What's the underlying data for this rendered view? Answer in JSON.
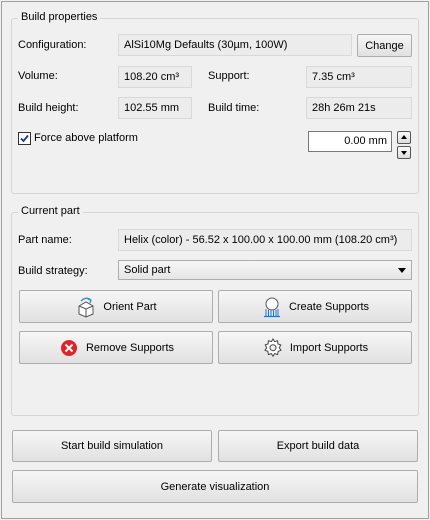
{
  "build_properties": {
    "title": "Build properties",
    "configuration_label": "Configuration:",
    "configuration_value": "AlSi10Mg Defaults (30µm, 100W)",
    "change_label": "Change",
    "volume_label": "Volume:",
    "volume_value": "108.20 cm³",
    "support_label": "Support:",
    "support_value": "7.35 cm³",
    "build_height_label": "Build height:",
    "build_height_value": "102.55 mm",
    "build_time_label": "Build time:",
    "build_time_value": "28h 26m 21s",
    "force_above_label": "Force above platform",
    "force_above_checked": true,
    "offset_value": "0.00 mm"
  },
  "current_part": {
    "title": "Current part",
    "part_name_label": "Part name:",
    "part_name_value": "Helix (color) - 56.52 x 100.00 x 100.00 mm (108.20 cm³)",
    "build_strategy_label": "Build strategy:",
    "build_strategy_value": "Solid part",
    "orient_part_label": "Orient Part",
    "create_supports_label": "Create Supports",
    "remove_supports_label": "Remove Supports",
    "import_supports_label": "Import Supports"
  },
  "actions": {
    "start_simulation_label": "Start build simulation",
    "export_data_label": "Export build data",
    "generate_visualization_label": "Generate visualization"
  },
  "icons": {
    "orient": "orient-part-icon",
    "create_supports": "create-supports-icon",
    "remove_supports": "remove-icon",
    "import_supports": "gear-icon"
  },
  "colors": {
    "remove_icon": "#e0232b",
    "create_supports_icon": "#2b6fd6",
    "orient_icon": "#3a8fd8"
  }
}
